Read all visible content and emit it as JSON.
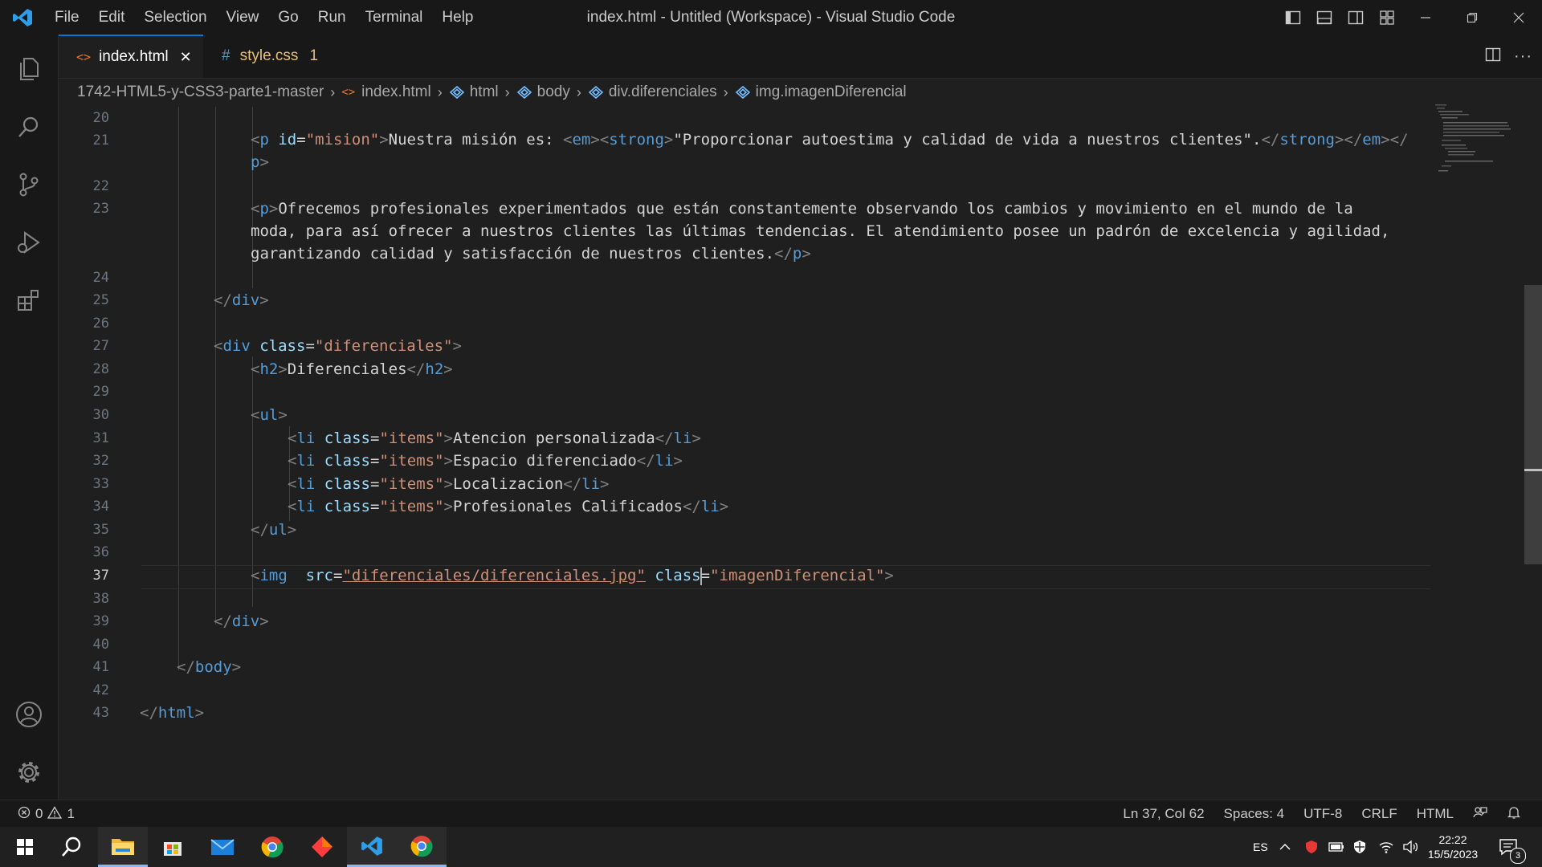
{
  "titlebar": {
    "menu": [
      "File",
      "Edit",
      "Selection",
      "View",
      "Go",
      "Run",
      "Terminal",
      "Help"
    ],
    "title": "index.html - Untitled (Workspace) - Visual Studio Code"
  },
  "tabs": [
    {
      "label": "index.html",
      "icon": "html-file-icon",
      "close": "✕",
      "active": true
    },
    {
      "label": "style.css",
      "icon": "css-file-icon",
      "glyph": "#",
      "badge": "1",
      "active": false
    }
  ],
  "breadcrumb": {
    "folder": "1742-HTML5-y-CSS3-parte1-master",
    "file": "index.html",
    "html": "html",
    "body": "body",
    "div": "div.diferenciales",
    "img": "img.imagenDiferencial"
  },
  "editor": {
    "line_numbers": [
      "20",
      "21",
      "22",
      "23",
      "24",
      "25",
      "26",
      "27",
      "28",
      "29",
      "30",
      "31",
      "32",
      "33",
      "34",
      "35",
      "36",
      "37",
      "38",
      "39",
      "40",
      "41",
      "42",
      "43"
    ],
    "current_line": "37",
    "lines": {
      "l21a_text": "Nuestra misión es: ",
      "l21a_quote": "\"Proporcionar autoestima y calidad de vida a nuestros clientes\".",
      "l23a_text": "Ofrecemos profesionales experimentados que están constantemente observando los cambios y movimiento en el mundo de la",
      "l23b_text": "moda, para así ofrecer a nuestros clientes las últimas tendencias. El atendimiento posee un padrón de excelencia y agilidad,",
      "l23c_text": "garantizando calidad y satisfacción de nuestros clientes.",
      "diferenciales_class": "\"diferenciales\"",
      "h2_text": "Diferenciales",
      "items_class": "\"items\"",
      "li_items": [
        "Atencion personalizada",
        "Espacio diferenciado",
        "Localizacion",
        "Profesionales Calificados"
      ],
      "img_src": "\"diferenciales/diferenciales.jpg\"",
      "img_class": "\"imagenDiferencial\"",
      "mision_id": "\"mision\""
    }
  },
  "statusbar": {
    "errors": "0",
    "warnings": "1",
    "position": "Ln 37, Col 62",
    "spaces": "Spaces: 4",
    "encoding": "UTF-8",
    "eol": "CRLF",
    "language": "HTML"
  },
  "taskbar": {
    "lang": "ES",
    "time": "22:22",
    "date": "15/5/2023",
    "notifications": "3"
  },
  "colors": {
    "accent": "#0078d4",
    "tag": "#569cd6",
    "attr": "#9cdcfe",
    "string": "#ce9178",
    "css_file": "#e5c07b",
    "html_file": "#e37933"
  }
}
